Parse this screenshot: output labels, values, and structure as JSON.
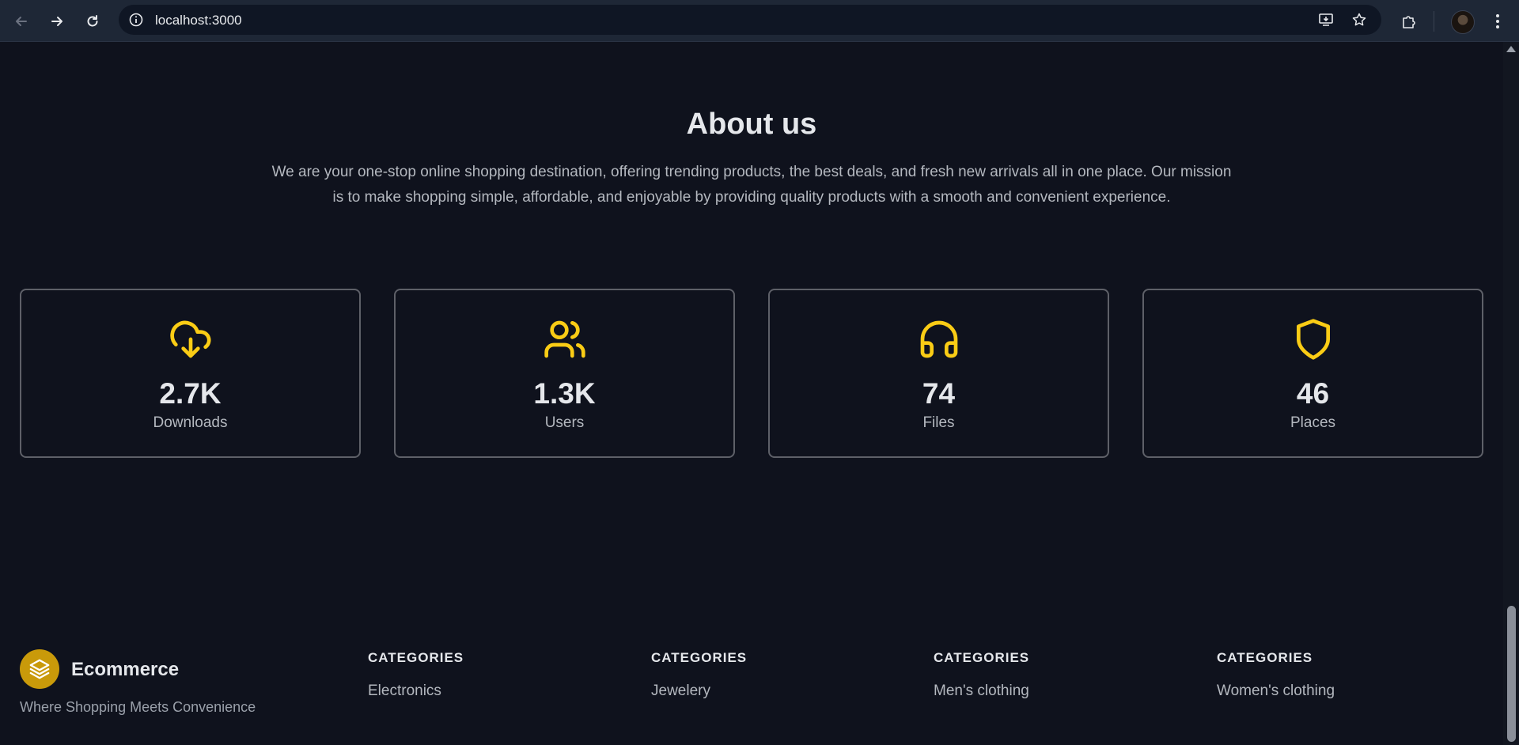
{
  "browser": {
    "url": "localhost:3000"
  },
  "about": {
    "title": "About us",
    "description": "We are your one-stop online shopping destination, offering trending products, the best deals, and fresh new arrivals all in one place. Our mission is to make shopping simple, affordable, and enjoyable by providing quality products with a smooth and convenient experience."
  },
  "stats": [
    {
      "value": "2.7K",
      "label": "Downloads",
      "icon": "cloud-download-icon"
    },
    {
      "value": "1.3K",
      "label": "Users",
      "icon": "users-icon"
    },
    {
      "value": "74",
      "label": "Files",
      "icon": "headphones-icon"
    },
    {
      "value": "46",
      "label": "Places",
      "icon": "shield-icon"
    }
  ],
  "footer": {
    "brand": "Ecommerce",
    "tagline": "Where Shopping Meets Convenience",
    "columns": [
      {
        "heading": "CATEGORIES",
        "link": "Electronics"
      },
      {
        "heading": "CATEGORIES",
        "link": "Jewelery"
      },
      {
        "heading": "CATEGORIES",
        "link": "Men's clothing"
      },
      {
        "heading": "CATEGORIES",
        "link": "Women's clothing"
      }
    ]
  },
  "colors": {
    "background": "#0f121d",
    "accent": "#facc15",
    "card_border": "#5e6068",
    "logo_bg": "#c99a0a"
  }
}
